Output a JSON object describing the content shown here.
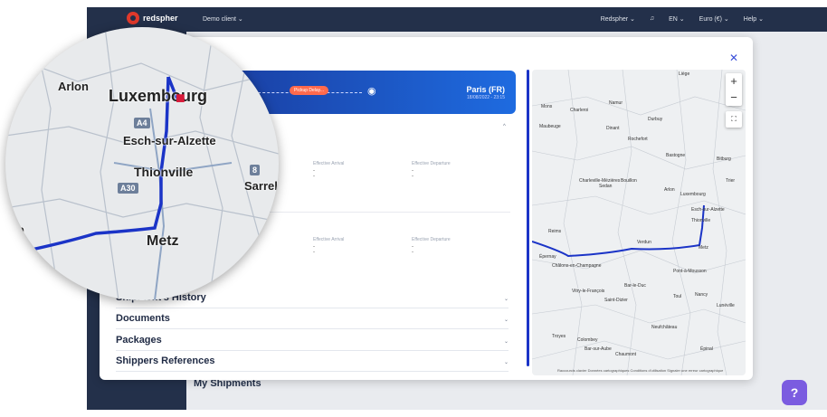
{
  "topbar": {
    "brand": "redspher",
    "client": "Demo client ⌄",
    "user": "Redspher ⌄",
    "lang": "EN ⌄",
    "currency": "Euro (€) ⌄",
    "help": "Help ⌄"
  },
  "background": {
    "section_title": "My Shipments"
  },
  "modal": {
    "route": {
      "status": "Pickup Delay...",
      "destination_city": "Paris (FR)",
      "destination_datetime": "18/08/2022 - 23:15"
    },
    "stops": [
      {
        "arrival_label": "Effective Arrival",
        "departure_label": "Effective Departure",
        "arrival_value": "-",
        "departure_value": "-"
      },
      {
        "arrival_label": "Effective Arrival",
        "departure_label": "Effective Departure",
        "arrival_value": "-",
        "departure_value": "-"
      }
    ],
    "sections": [
      {
        "title": "Shipment's History"
      },
      {
        "title": "Documents"
      },
      {
        "title": "Packages"
      },
      {
        "title": "Shippers References"
      }
    ]
  },
  "map": {
    "places": [
      "Liège",
      "Namur",
      "Mons",
      "Charleroi",
      "Maubeuge",
      "Dinant",
      "Durbuy",
      "Rochefort",
      "Bastogne",
      "Bitburg",
      "Charleville-Mézières",
      "Sedan",
      "Bouillon",
      "Arlon",
      "Luxembourg",
      "Trier",
      "Esch-sur-Alzette",
      "Thionville",
      "Reims",
      "Verdun",
      "Metz",
      "Épernay",
      "Châlons-en-Champagne",
      "Pont-à-Mousson",
      "Vitry-le-François",
      "Bar-le-Duc",
      "Saint-Dizier",
      "Toul",
      "Nancy",
      "Lunéville",
      "Troyes",
      "Neufchâteau",
      "Colombey",
      "Chaumont",
      "Bar-sur-Aube",
      "Épinal"
    ],
    "zoom_in": "+",
    "zoom_out": "−",
    "credit": "Raccourcis clavier   Données cartographiques   Conditions d'utilisation   Signaler une erreur cartographique"
  },
  "magnifier": {
    "places": [
      "Arlon",
      "Luxembourg",
      "Esch-sur-Alzette",
      "Thionville",
      "Sarrel",
      "Metz",
      "un"
    ],
    "highways": [
      "A4",
      "A30",
      "8"
    ]
  },
  "help_fab": "?"
}
